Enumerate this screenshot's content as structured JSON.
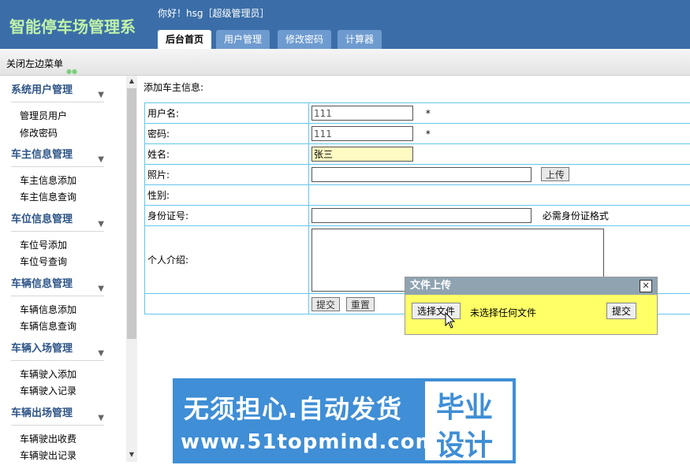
{
  "header": {
    "title": "智能停车场管理系",
    "greeting": "你好！hsg［超级管理员］",
    "tabs": [
      {
        "label": "后台首页",
        "active": true
      },
      {
        "label": "用户管理",
        "active": false
      },
      {
        "label": "修改密码",
        "active": false
      },
      {
        "label": "计算器",
        "active": false
      }
    ]
  },
  "toolbar": {
    "close_menu": "关闭左边菜单"
  },
  "sidebar": {
    "groups": [
      {
        "title": "系统用户管理",
        "items": [
          "管理员用户",
          "修改密码"
        ]
      },
      {
        "title": "车主信息管理",
        "items": [
          "车主信息添加",
          "车主信息查询"
        ]
      },
      {
        "title": "车位信息管理",
        "items": [
          "车位号添加",
          "车位号查询"
        ]
      },
      {
        "title": "车辆信息管理",
        "items": [
          "车辆信息添加",
          "车辆信息查询"
        ]
      },
      {
        "title": "车辆入场管理",
        "items": [
          "车辆驶入添加",
          "车辆驶入记录"
        ]
      },
      {
        "title": "车辆出场管理",
        "items": [
          "车辆驶出收费",
          "车辆驶出记录"
        ]
      }
    ]
  },
  "form": {
    "caption": "添加车主信息:",
    "fields": {
      "username": {
        "label": "用户名:",
        "value": "111",
        "mark": "*"
      },
      "password": {
        "label": "密码:",
        "value": "111",
        "mark": "*"
      },
      "name": {
        "label": "姓名:",
        "value": "张三"
      },
      "photo": {
        "label": "照片:",
        "value": "",
        "button": "上传"
      },
      "gender": {
        "label": "性别:"
      },
      "idcard": {
        "label": "身份证号:",
        "value": "",
        "hint": "必需身份证格式"
      },
      "intro": {
        "label": "个人介绍:",
        "value": ""
      }
    },
    "submit": "提交",
    "reset": "重置"
  },
  "upload_dialog": {
    "title": "文件上传",
    "close": "✕",
    "choose_file": "选择文件",
    "no_file": "未选择任何文件",
    "submit": "提交"
  },
  "watermark": {
    "line1": "无须担心.自动发货",
    "line2": "www.51topmind.com",
    "right1": "毕业",
    "right2": "设计"
  },
  "colors": {
    "header_bg": "#3b6ea8",
    "title_color": "#bff2a8",
    "table_border": "#64c7ea",
    "dialog_bg": "#ffff66",
    "watermark_bg": "#3f8ed6"
  }
}
